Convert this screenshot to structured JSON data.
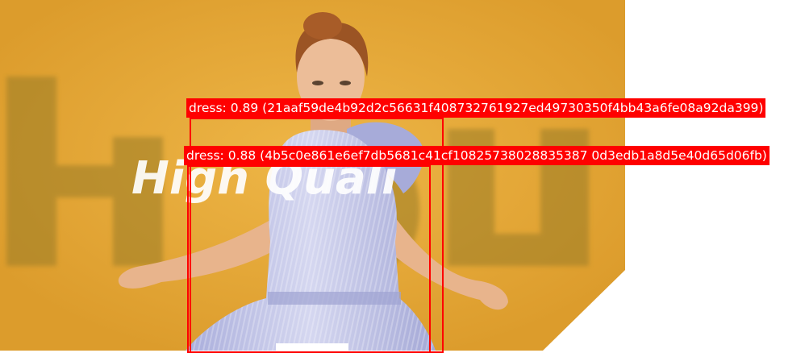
{
  "image": {
    "background": "#ffffff",
    "photo_bg": "#e3a632",
    "dress_color": "#b9bde2",
    "skin_color": "#e9b792",
    "hair_color": "#a0531f",
    "overlay_text": "High Quali"
  },
  "detections": [
    {
      "label": "dress: 0.89 (21aaf59de4b92d2c56631f408732761927ed49730350f4bb43a6fe08a92da399)",
      "color": "#ff0000"
    },
    {
      "label": "dress: 0.88 (4b5c0e861e6ef7db5681c41cf10825738028835387 0d3edb1a8d5e40d65d06fb)",
      "color": "#ff0000"
    }
  ]
}
